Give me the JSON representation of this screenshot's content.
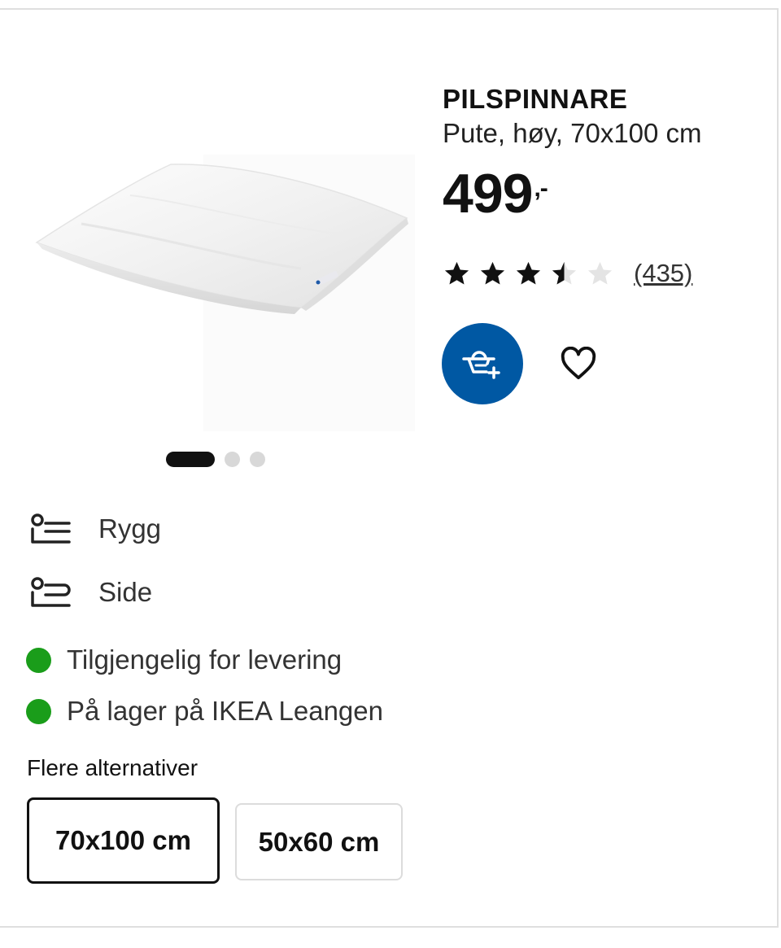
{
  "product": {
    "name": "PILSPINNARE",
    "description": "Pute, høy, 70x100 cm",
    "price": "499",
    "price_suffix": ",-"
  },
  "rating": {
    "value": 3.5,
    "max": 5,
    "count_label": "(435)"
  },
  "gallery": {
    "image_count": 3,
    "active_index": 0
  },
  "sleep_positions": [
    {
      "label": "Rygg",
      "icon": "back-sleeper-icon"
    },
    {
      "label": "Side",
      "icon": "side-sleeper-icon"
    }
  ],
  "availability": [
    {
      "label": "Tilgjengelig for levering",
      "status_color": "#1a9d1a"
    },
    {
      "label": "På lager på IKEA Leangen",
      "status_color": "#1a9d1a"
    }
  ],
  "options": {
    "heading": "Flere alternativer",
    "items": [
      {
        "label": "70x100 cm",
        "selected": true
      },
      {
        "label": "50x60 cm",
        "selected": false
      }
    ]
  },
  "colors": {
    "accent": "#0058a3",
    "stock": "#1a9d1a"
  }
}
